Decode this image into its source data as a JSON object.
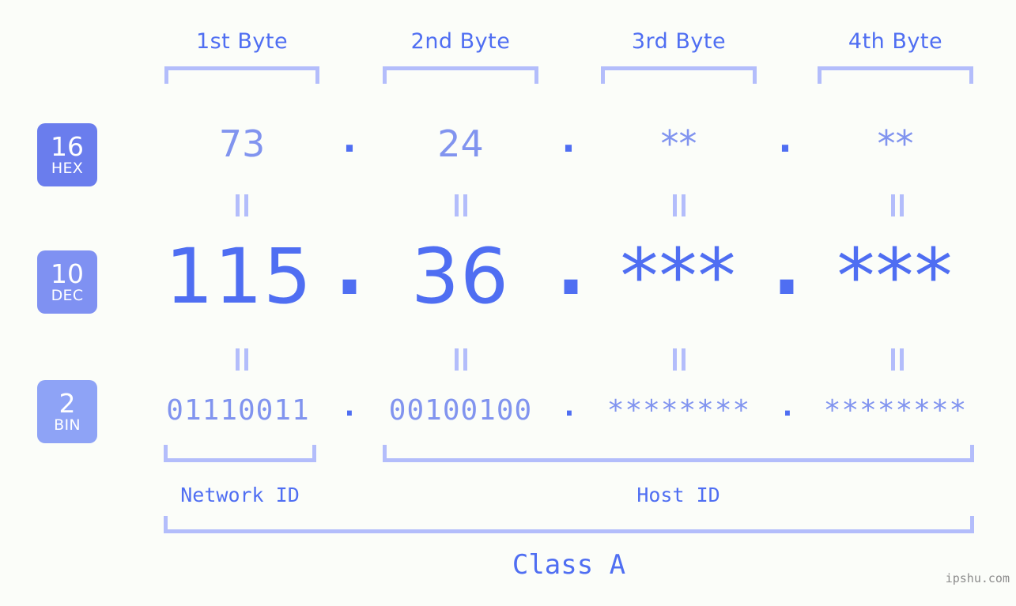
{
  "watermark": "ipshu.com",
  "class_label": "Class A",
  "byte_headers": [
    {
      "label": "1st Byte"
    },
    {
      "label": "2nd Byte"
    },
    {
      "label": "3rd Byte"
    },
    {
      "label": "4th Byte"
    }
  ],
  "bases": [
    {
      "id": "hex",
      "number": "16",
      "name": "HEX",
      "color": "#6a7ded"
    },
    {
      "id": "dec",
      "number": "10",
      "name": "DEC",
      "color": "#7f91f2"
    },
    {
      "id": "bin",
      "number": "2",
      "name": "BIN",
      "color": "#8ea3f6"
    }
  ],
  "rows": {
    "hex": {
      "values": [
        "73",
        "24",
        "**",
        "**"
      ],
      "separator": "."
    },
    "dec": {
      "values": [
        "115",
        "36",
        "***",
        "***"
      ],
      "separator": "."
    },
    "bin": {
      "values": [
        "01110011",
        "00100100",
        "********",
        "********"
      ],
      "separator": "."
    }
  },
  "segments": [
    {
      "label": "Network ID"
    },
    {
      "label": "Host ID"
    }
  ],
  "colors": {
    "background": "#fbfdf9",
    "accent_strong": "#4f6ef2",
    "accent_mid": "#8194ef",
    "accent_light": "#b3bdfb",
    "watermark": "#8c8c8c"
  }
}
